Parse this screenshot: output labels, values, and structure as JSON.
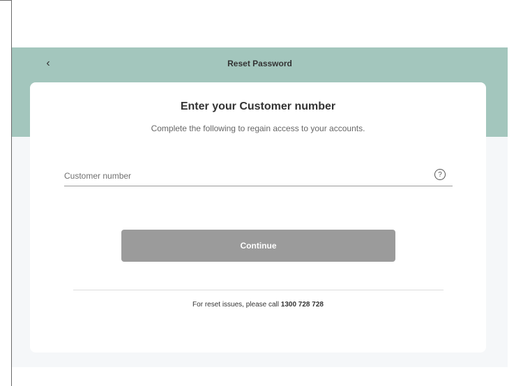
{
  "header": {
    "back_icon": "‹",
    "title": "Reset Password",
    "background_color": "#a3c6bd"
  },
  "card": {
    "heading": "Enter your Customer number",
    "subheading": "Complete the following to regain access to your accounts."
  },
  "form": {
    "customer_number_placeholder": "Customer number",
    "customer_number_value": "",
    "help_icon": "?"
  },
  "actions": {
    "continue_label": "Continue",
    "continue_color": "#9b9b9b"
  },
  "footer": {
    "text": "For reset issues, please call ",
    "phone": "1300 728 728"
  }
}
